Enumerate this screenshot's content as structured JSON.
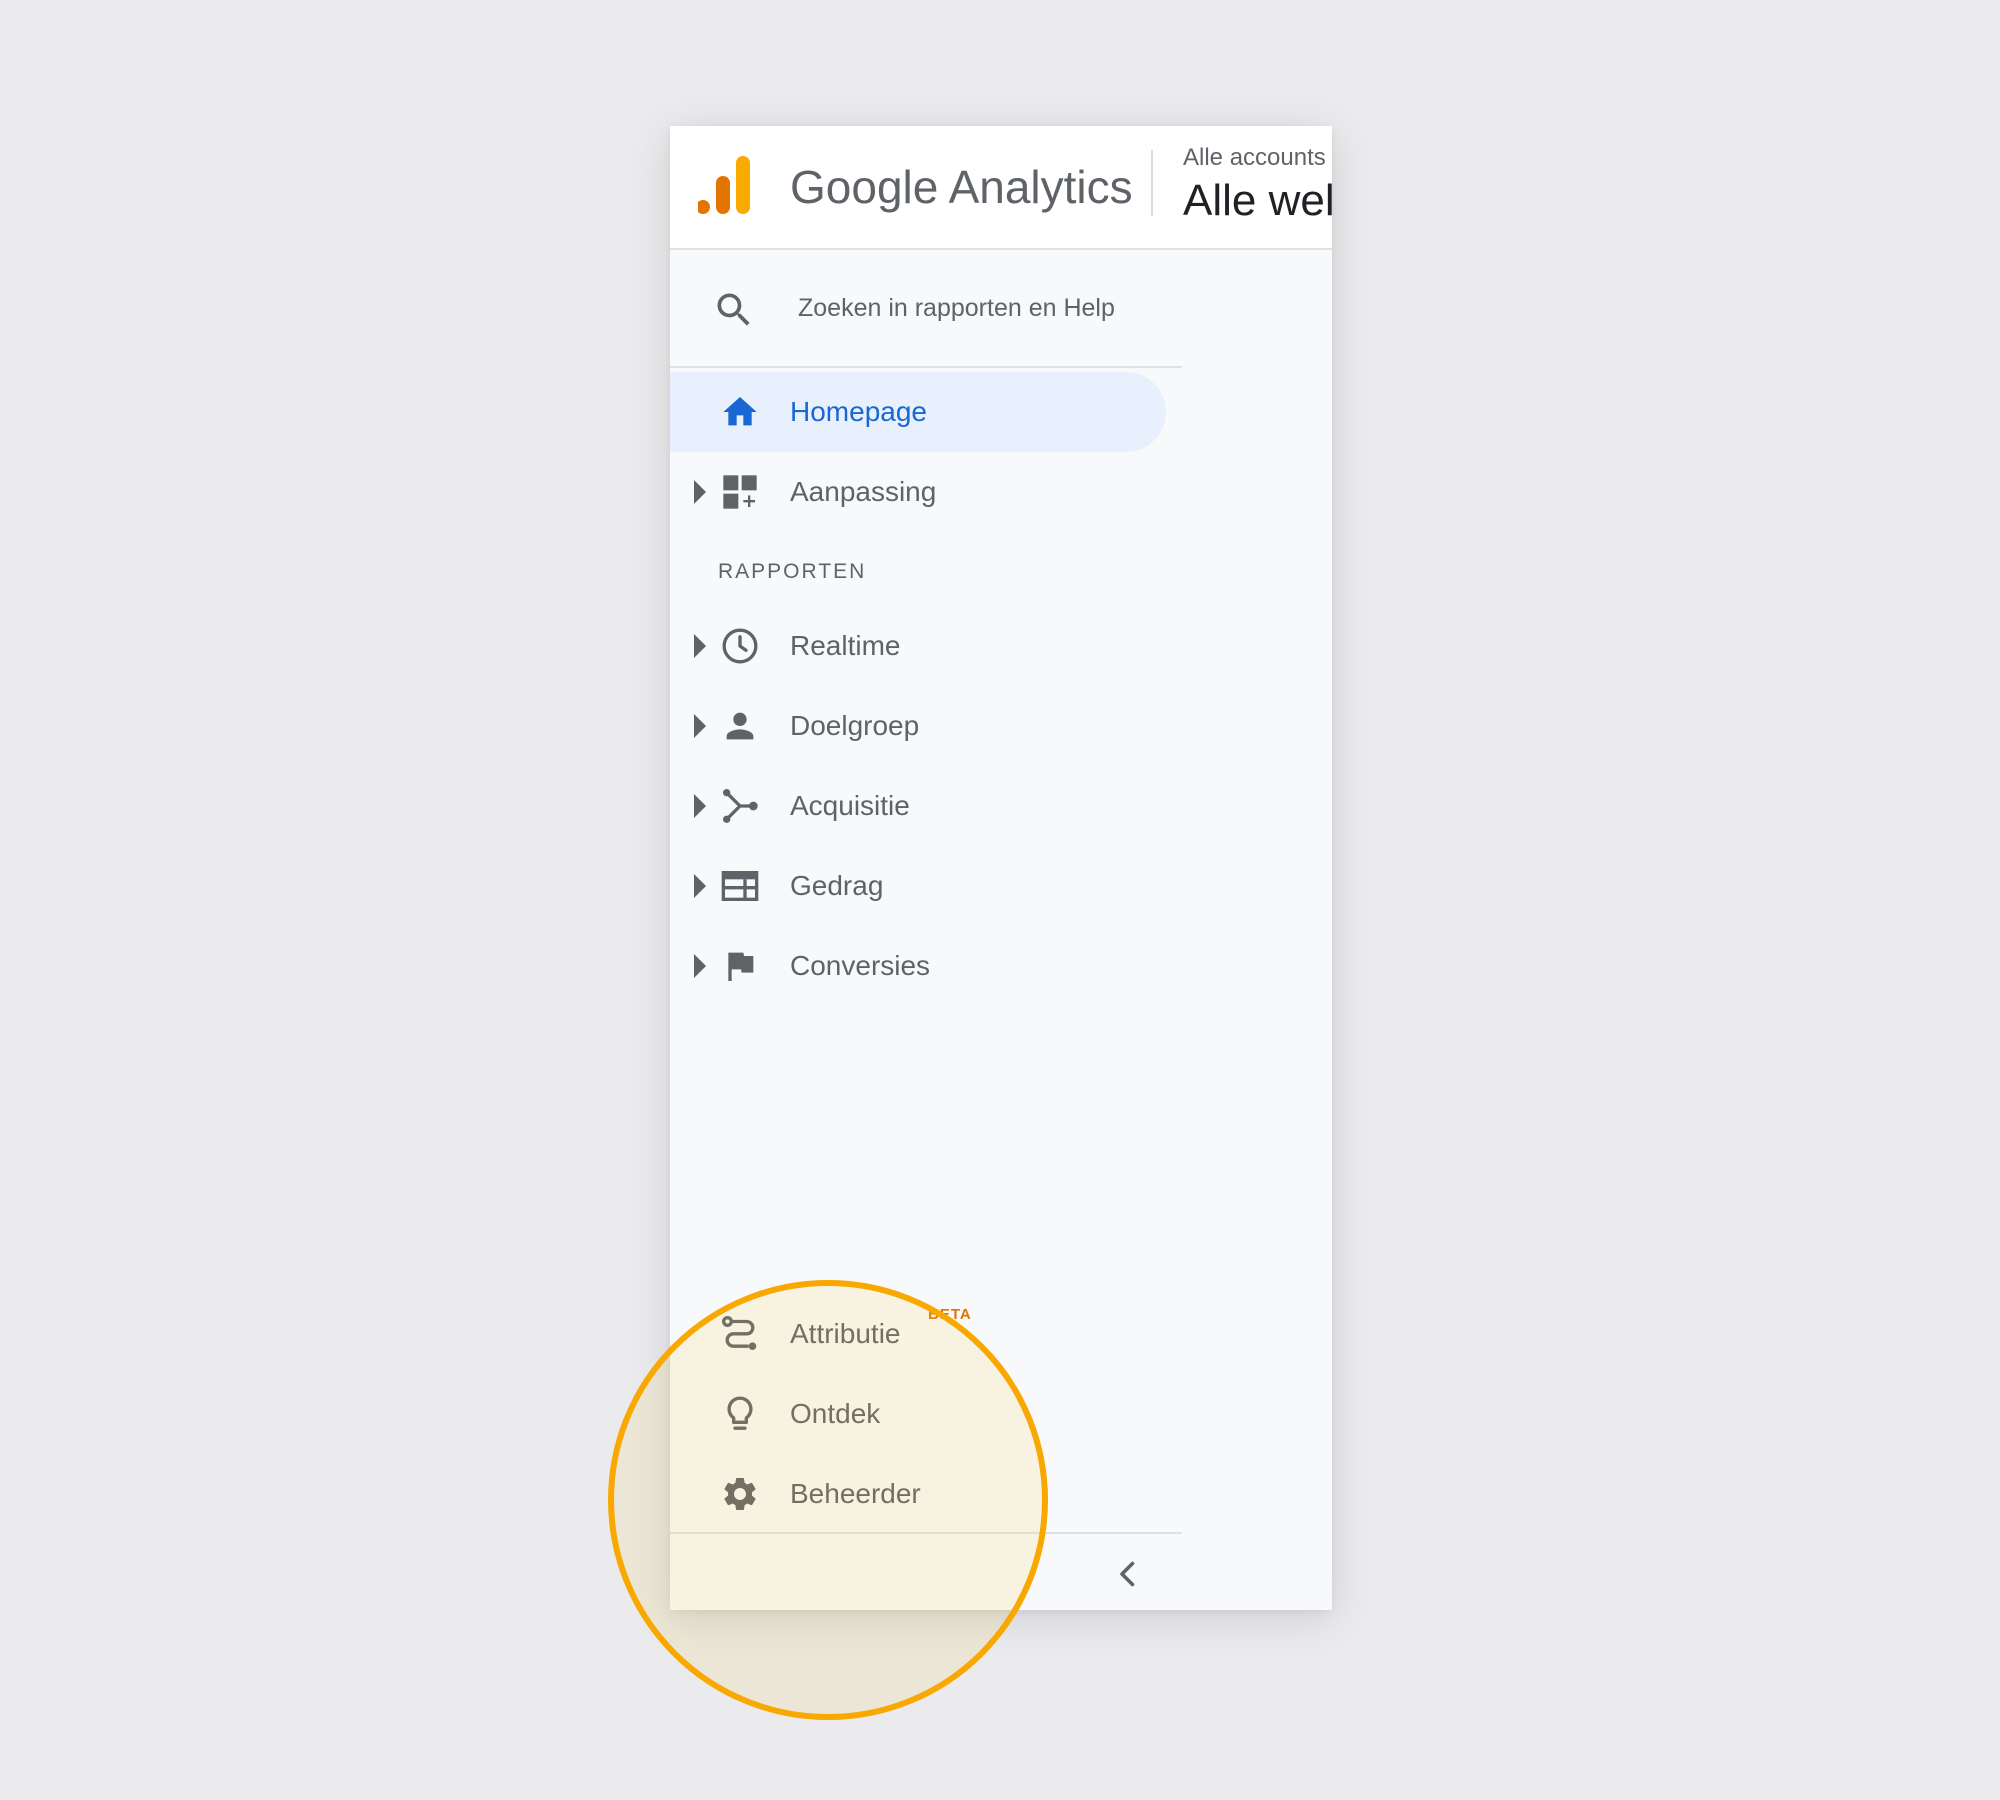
{
  "header": {
    "brand": "Google Analytics",
    "account_small": "Alle accounts",
    "account_big": "Alle wel"
  },
  "search": {
    "placeholder": "Zoeken in rapporten en Help"
  },
  "nav": {
    "home": "Homepage",
    "customization": "Aanpassing",
    "reports_header": "RAPPORTEN",
    "realtime": "Realtime",
    "audience": "Doelgroep",
    "acquisition": "Acquisitie",
    "behavior": "Gedrag",
    "conversions": "Conversies",
    "attribution": "Attributie",
    "attribution_badge": "BETA",
    "discover": "Ontdek",
    "admin": "Beheerder"
  },
  "colors": {
    "accent_blue": "#1967d2",
    "active_bg": "#e8f0fe",
    "highlight_ring": "#f8a800",
    "beta_badge": "#e37400",
    "logo_dark": "#e37400",
    "logo_light": "#f9ab00"
  },
  "icons": {
    "logo": "analytics-logo-icon",
    "search": "search-icon",
    "home": "home-icon",
    "customization": "dashboard-add-icon",
    "realtime": "clock-icon",
    "audience": "person-icon",
    "acquisition": "fork-icon",
    "behavior": "web-page-icon",
    "conversions": "flag-icon",
    "attribution": "route-icon",
    "discover": "lightbulb-icon",
    "admin": "gear-icon",
    "collapse": "chevron-left-icon"
  }
}
